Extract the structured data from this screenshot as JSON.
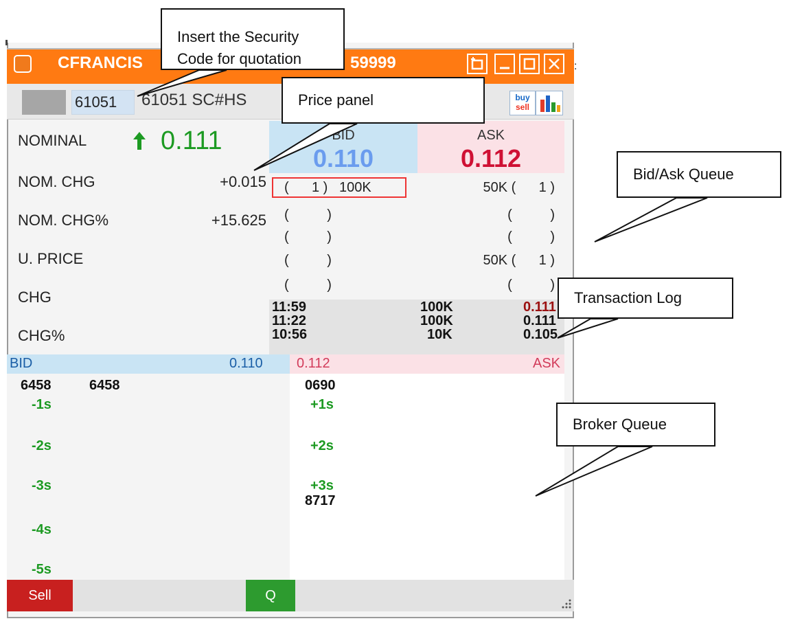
{
  "window": {
    "title_left": "CFRANCIS",
    "title_right": "59999",
    "buttons": [
      "pin-icon",
      "minimize-icon",
      "maximize-icon",
      "close-icon"
    ]
  },
  "toolbar": {
    "code_value": "61051",
    "security_name": "61051 SC#HS",
    "buysell_top": "buy",
    "buysell_bottom": "sell"
  },
  "price_panel": {
    "rows": [
      {
        "label": "NOMINAL",
        "value": "0.111"
      },
      {
        "label": "NOM. CHG",
        "value": "+0.015"
      },
      {
        "label": "NOM. CHG%",
        "value": "+15.625"
      },
      {
        "label": "U. PRICE",
        "value": ""
      },
      {
        "label": "CHG",
        "value": ""
      },
      {
        "label": "CHG%",
        "value": ""
      }
    ],
    "nominal_direction": "up"
  },
  "bid_ask": {
    "bid_label": "BID",
    "bid_price": "0.110",
    "ask_label": "ASK",
    "ask_price": "0.112",
    "bid_queue": [
      "(      1 )   100K",
      "(          )",
      "(          )",
      "(          )",
      "(          )"
    ],
    "ask_queue": [
      "50K (      1 )",
      "(          )",
      "(          )",
      "50K (      1 )",
      "(          )"
    ]
  },
  "transactions": [
    {
      "time": "11:59",
      "volume": "100K",
      "price": "0.111",
      "color": "#9b1010"
    },
    {
      "time": "11:22",
      "volume": "100K",
      "price": "0.111",
      "color": "#111111"
    },
    {
      "time": "10:56",
      "volume": "10K",
      "price": "0.105",
      "color": "#111111"
    }
  ],
  "broker_queue": {
    "bid_label": "BID",
    "bid_price": "0.110",
    "ask_price": "0.112",
    "ask_label": "ASK",
    "bid_top": [
      "6458",
      "6458"
    ],
    "bid_steps": [
      "-1s",
      "-2s",
      "-3s",
      "-4s",
      "-5s"
    ],
    "ask_top": [
      "0690"
    ],
    "ask_steps": [
      "+1s",
      "+2s",
      "+3s"
    ],
    "ask_after": "8717"
  },
  "bottom": {
    "sell_label": "Sell",
    "q_label": "Q"
  },
  "callouts": {
    "security_line1": "Insert the Security",
    "security_line2": "Code for quotation",
    "price_panel": "Price panel",
    "bid_ask": "Bid/Ask Queue",
    "transaction_log": "Transaction Log",
    "broker_queue": "Broker Queue"
  },
  "colors": {
    "title_bar": "#ff7a12",
    "bid": "#6a9cee",
    "ask": "#cf1134",
    "nominal": "#1c9a22",
    "sell": "#c8201f",
    "q": "#2d9b2f"
  }
}
